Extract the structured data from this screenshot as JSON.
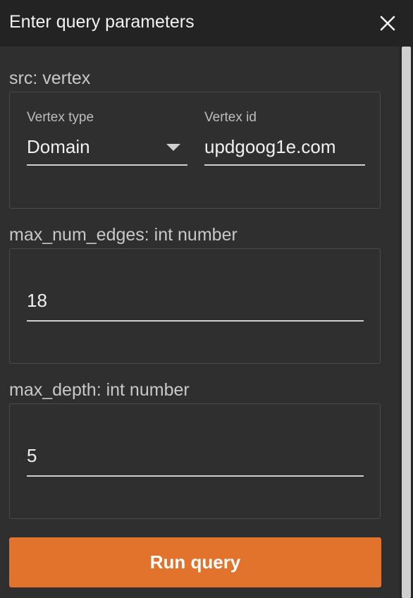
{
  "dialog": {
    "title": "Enter query parameters",
    "close_icon": "close-icon"
  },
  "src": {
    "label": "src: vertex",
    "vertex_type": {
      "label": "Vertex type",
      "value": "Domain",
      "icon": "dropdown-arrow-icon"
    },
    "vertex_id": {
      "label": "Vertex id",
      "value": "updgoog1e.com"
    }
  },
  "max_num_edges": {
    "label": "max_num_edges: int number",
    "value": "18"
  },
  "max_depth": {
    "label": "max_depth: int number",
    "value": "5"
  },
  "actions": {
    "run_label": "Run query"
  },
  "colors": {
    "accent": "#e1732d",
    "background": "#2f2f2f",
    "titlebar": "#232323"
  }
}
